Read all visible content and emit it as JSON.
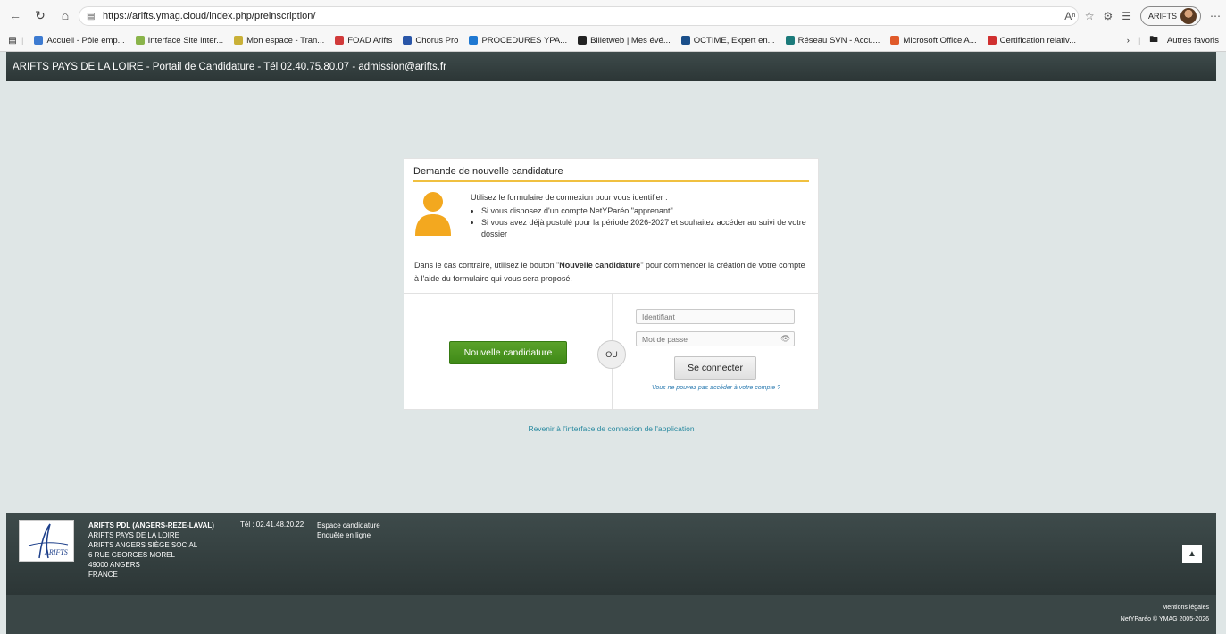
{
  "browser": {
    "url": "https://arifts.ymag.cloud/index.php/preinscription/",
    "profile_name": "ARIFTS",
    "bookmarks": [
      {
        "label": "Accueil - Pôle emp...",
        "icon": "star-icon",
        "color": "#3d7bd1"
      },
      {
        "label": "Interface Site inter...",
        "icon": "leaf-icon",
        "color": "#8ab44a"
      },
      {
        "label": "Mon espace - Tran...",
        "icon": "bar-icon",
        "color": "#c9b037"
      },
      {
        "label": "FOAD Arifts",
        "icon": "m-icon",
        "color": "#d13a3a"
      },
      {
        "label": "Chorus Pro",
        "icon": "chorus-icon",
        "color": "#2a56a8"
      },
      {
        "label": "PROCEDURES YPA...",
        "icon": "cloud-icon",
        "color": "#1f78d1"
      },
      {
        "label": "Billetweb | Mes évé...",
        "icon": "b-icon",
        "color": "#222222"
      },
      {
        "label": "OCTIME, Expert en...",
        "icon": "oc-icon",
        "color": "#1a4f8a"
      },
      {
        "label": "Réseau SVN - Accu...",
        "icon": "s-icon",
        "color": "#1b7a7a"
      },
      {
        "label": "Microsoft Office A...",
        "icon": "office-icon",
        "color": "#e05a2a"
      },
      {
        "label": "Certification relativ...",
        "icon": "flag-icon",
        "color": "#d03030"
      }
    ],
    "other_bookmarks": "Autres favoris"
  },
  "header": {
    "title": "ARIFTS PAYS DE LA LOIRE - Portail de Candidature - Tél 02.40.75.80.07 - admission@arifts.fr"
  },
  "card": {
    "title": "Demande de nouvelle candidature",
    "intro": "Utilisez le formulaire de connexion pour vous identifier :",
    "bullets": [
      "Si vous disposez d'un compte NetYParéo \"apprenant\"",
      "Si vous avez déjà postulé pour la période 2026-2027 et souhaitez accéder au suivi de votre dossier"
    ],
    "other_pre": "Dans le cas contraire, utilisez le bouton \"",
    "other_bold": "Nouvelle candidature",
    "other_post": "\" pour commencer la création de votre compte à l'aide du formulaire qui vous sera proposé.",
    "new_button": "Nouvelle candidature",
    "ou": "OU",
    "id_placeholder": "Identifiant",
    "pw_placeholder": "Mot de passe",
    "login_button": "Se connecter",
    "forgot": "Vous ne pouvez pas accéder à votre compte ?"
  },
  "back_link": "Revenir à l'interface de connexion de l'application",
  "footer": {
    "org_name": "ARIFTS PDL (ANGERS-REZE-LAVAL)",
    "address_lines": [
      "ARIFTS PAYS DE LA LOIRE",
      "ARIFTS ANGERS SIÈGE SOCIAL",
      "6 RUE GEORGES MOREL",
      "49000 ANGERS",
      "FRANCE"
    ],
    "tel": "Tél : 02.41.48.20.22",
    "links": [
      "Espace candidature",
      "Enquête en ligne"
    ],
    "logo_text": "ARIFTS",
    "legal": "Mentions légales",
    "copyright": "NetYParéo © YMAG 2005-2026"
  },
  "colors": {
    "header_bg": "#2c3636",
    "accent": "#f0c040",
    "primary_button": "#4a9620",
    "link": "#2a8aa0",
    "page_bg": "#dfe6e6"
  }
}
